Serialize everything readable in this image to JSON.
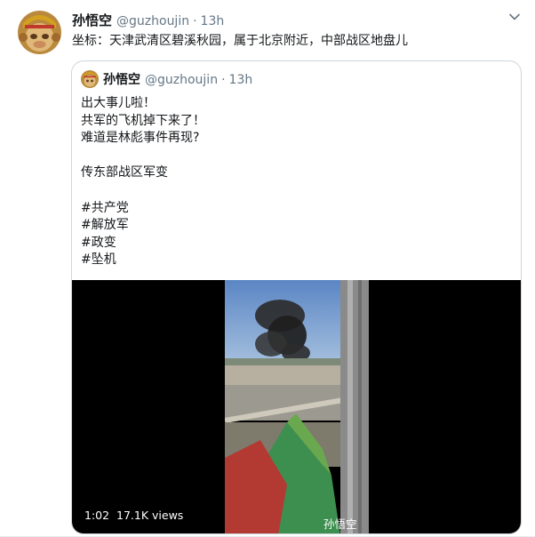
{
  "tweet": {
    "author_name": "孙悟空",
    "author_handle": "@guzhoujin",
    "separator": "·",
    "time": "13h",
    "text": "坐标：天津武清区碧溪秋园，属于北京附近，中部战区地盘儿"
  },
  "quoted": {
    "author_name": "孙悟空",
    "author_handle": "@guzhoujin",
    "separator": "·",
    "time": "13h",
    "lines": [
      "出大事儿啦！",
      "共军的飞机掉下来了！",
      "难道是林彪事件再现?",
      "",
      "传东部战区军变",
      "",
      "#共产党",
      "#解放军",
      "#政变",
      "#坠机"
    ],
    "video": {
      "duration": "1:02",
      "views": "17.1K views",
      "watermark": "孙悟空"
    }
  },
  "icons": {
    "caret": "chevron-down-icon",
    "avatar": "monkey-king-avatar"
  },
  "colors": {
    "secondary_text": "#657786",
    "border": "#ccd6dd",
    "video_background": "#000000"
  }
}
